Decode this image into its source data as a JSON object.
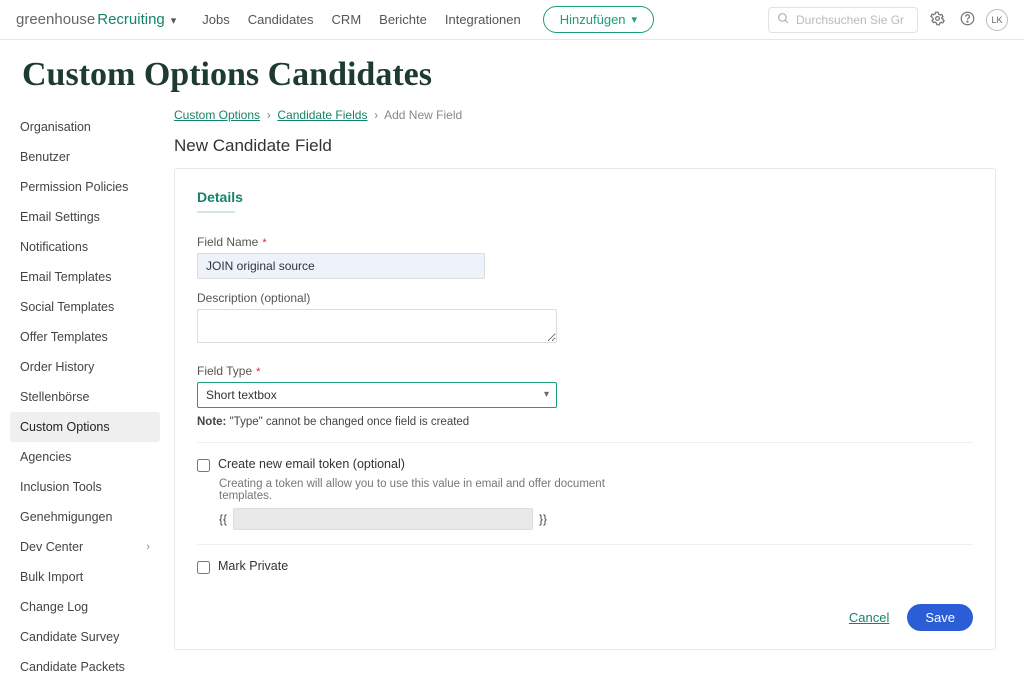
{
  "brand": {
    "part1": "greenhouse",
    "part2": "Recruiting"
  },
  "nav": {
    "items": [
      "Jobs",
      "Candidates",
      "CRM",
      "Berichte",
      "Integrationen"
    ],
    "add_label": "Hinzufügen",
    "search_placeholder": "Durchsuchen Sie Gr",
    "avatar_initials": "LK"
  },
  "page_title": "Custom Options Candidates",
  "sidebar": {
    "items": [
      "Organisation",
      "Benutzer",
      "Permission Policies",
      "Email Settings",
      "Notifications",
      "Email Templates",
      "Social Templates",
      "Offer Templates",
      "Order History",
      "Stellenbörse",
      "Custom Options",
      "Agencies",
      "Inclusion Tools",
      "Genehmigungen",
      "Dev Center",
      "Bulk Import",
      "Change Log",
      "Candidate Survey",
      "Candidate Packets"
    ],
    "active_index": 10,
    "expandable_index": 14
  },
  "breadcrumbs": {
    "a": "Custom Options",
    "b": "Candidate Fields",
    "c": "Add New Field"
  },
  "subtitle": "New Candidate Field",
  "form": {
    "section_title": "Details",
    "field_name_label": "Field Name",
    "field_name_value": "JOIN original source",
    "description_label": "Description (optional)",
    "description_value": "",
    "field_type_label": "Field Type",
    "field_type_value": "Short textbox",
    "note_prefix": "Note:",
    "note_text": "\"Type\" cannot be changed once field is created",
    "email_token_label": "Create new email token (optional)",
    "email_token_hint": "Creating a token will allow you to use this value in email and offer document templates.",
    "token_open": "{{",
    "token_close": "}}",
    "mark_private_label": "Mark Private",
    "cancel_label": "Cancel",
    "save_label": "Save"
  }
}
